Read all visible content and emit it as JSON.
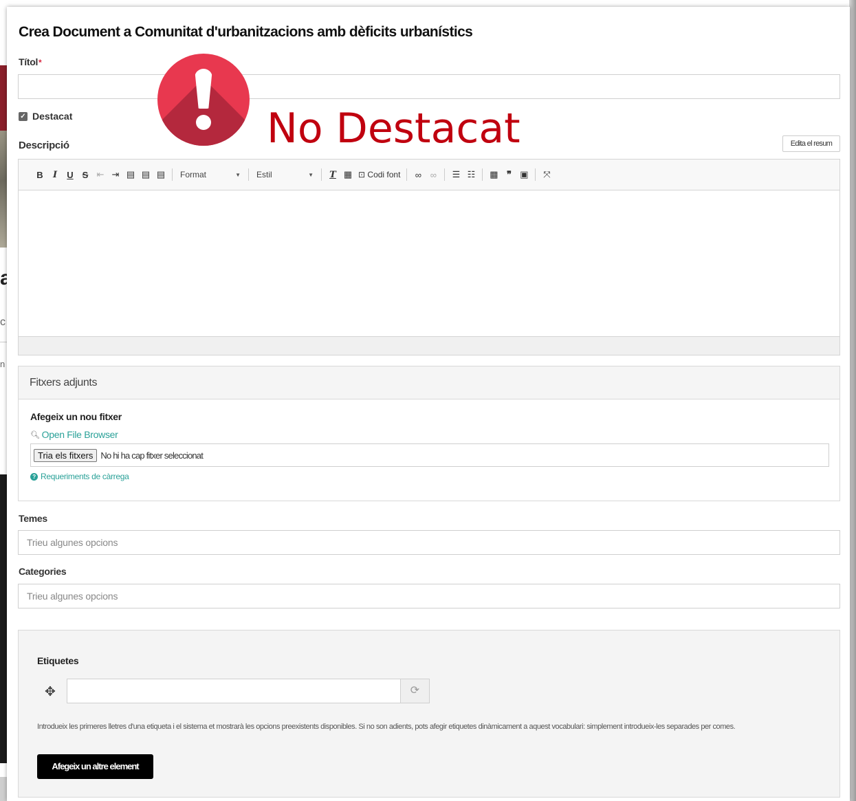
{
  "modal": {
    "title": "Crea Document a Comunitat d'urbanitzacions amb dèficits urbanístics"
  },
  "form": {
    "title_label": "Títol",
    "required_mark": "*",
    "featured_label": "Destacat",
    "featured_checked": true,
    "description_label": "Descripció",
    "edit_summary_label": "Edita el resum"
  },
  "overlay": {
    "warning_text": "No Destacat",
    "warning_icon": "exclamation-circle-icon",
    "warning_color": "#e8384f",
    "text_color": "#c0000f"
  },
  "editor": {
    "format_label": "Format",
    "style_label": "Estil",
    "source_label": "Codi font"
  },
  "attachments": {
    "header": "Fitxers adjunts",
    "add_label": "Afegeix un nou fitxer",
    "browser_link": "Open File Browser",
    "choose_button": "Tria els fitxers",
    "no_file_text": "No hi ha cap fitxer seleccionat",
    "requirements_link": "Requeriments de càrrega"
  },
  "themes": {
    "label": "Temes",
    "placeholder": "Trieu algunes opcions"
  },
  "categories": {
    "label": "Categories",
    "placeholder": "Trieu algunes opcions"
  },
  "tags": {
    "label": "Etiquetes",
    "help": "Introdueix les primeres lletres d'una etiqueta i el sistema et mostrarà les opcions preexistents disponibles. Si no son adients, pots afegir etiquetes dinàmicament a aquest vocabulari: simplement introdueix-les separades per comes.",
    "add_button": "Afegeix un altre element"
  },
  "background": {
    "letter_a": "a",
    "letter_c": "c",
    "letter_n": "n"
  }
}
